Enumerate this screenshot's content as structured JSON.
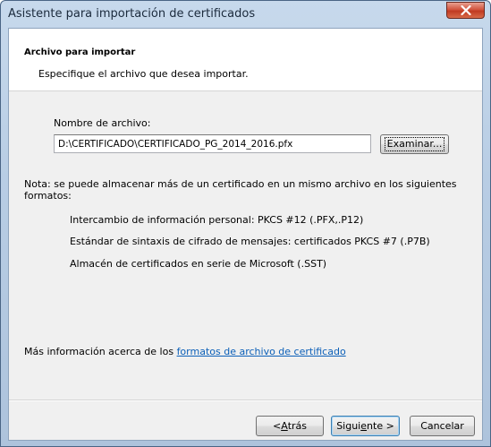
{
  "window": {
    "title": "Asistente para importación de certificados"
  },
  "header": {
    "title": "Archivo para importar",
    "subtitle": "Especifique el archivo que desea importar."
  },
  "file": {
    "label": "Nombre de archivo:",
    "value": "D:\\CERTIFICADO\\CERTIFICADO_PG_2014_2016.pfx",
    "browse_label": "Examinar..."
  },
  "note": {
    "line1": "Nota: se puede almacenar más de un certificado en un mismo archivo en los siguientes",
    "line2": "formatos:",
    "formats": [
      "Intercambio de información personal: PKCS #12 (.PFX,.P12)",
      "Estándar de sintaxis de cifrado de mensajes: certificados PKCS #7 (.P7B)",
      "Almacén de certificados en serie de Microsoft (.SST)"
    ]
  },
  "more_info": {
    "prefix": "Más información acerca de los ",
    "link": "formatos de archivo de certificado"
  },
  "footer": {
    "back_label_pre": "< ",
    "back_label_acc": "A",
    "back_label_post": "trás",
    "next_label_pre": "Sigui",
    "next_label_acc": "e",
    "next_label_post": "nte >",
    "cancel_label": "Cancelar"
  },
  "icons": {
    "close": "close-icon"
  },
  "colors": {
    "close_button": "#c8452d",
    "link": "#0b5fb8",
    "frame": "#b8cde4"
  }
}
